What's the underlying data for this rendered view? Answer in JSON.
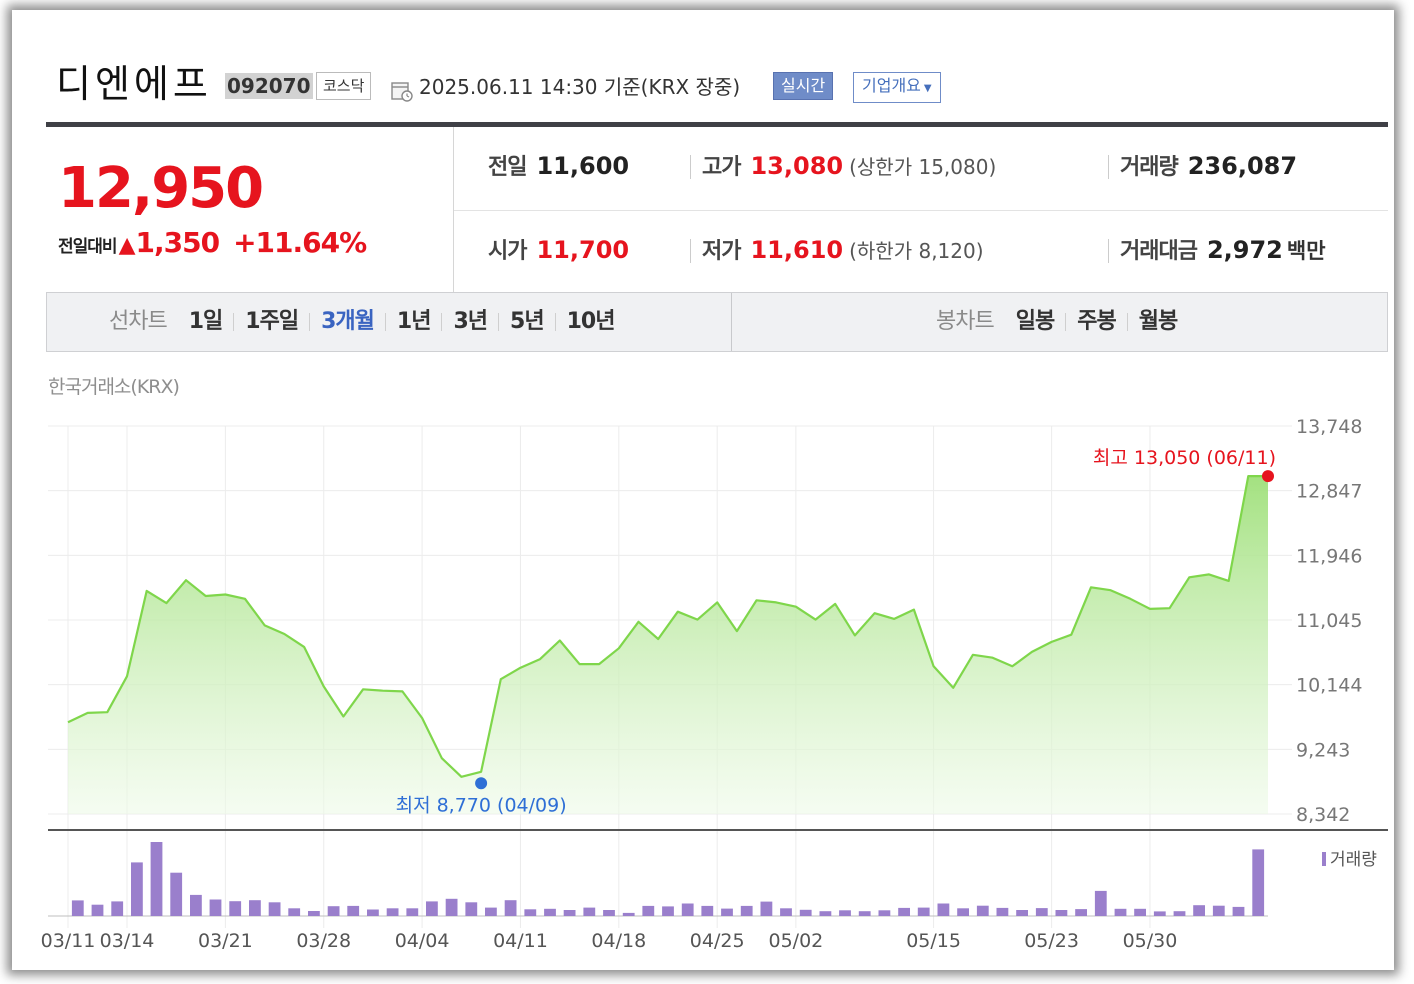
{
  "header": {
    "stock_name": "디엔에프",
    "stock_code": "092070",
    "market": "코스닥",
    "timestamp": "2025.06.11 14:30",
    "basis": "기준(KRX 장중)",
    "realtime_label": "실시간",
    "company_button_label": "기업개요"
  },
  "price": {
    "current": "12,950",
    "change_label": "전일대비",
    "change_amount": "1,350",
    "change_rate": "+11.64%"
  },
  "stats": {
    "prev_close_label": "전일",
    "prev_close": "11,600",
    "open_label": "시가",
    "open": "11,700",
    "high_label": "고가",
    "high": "13,080",
    "upper_limit_text": "(상한가 15,080)",
    "low_label": "저가",
    "low": "11,610",
    "lower_limit_text": "(하한가 8,120)",
    "volume_label": "거래량",
    "volume": "236,087",
    "trade_value_label": "거래대금",
    "trade_value": "2,972",
    "trade_value_unit": "백만"
  },
  "tabs": {
    "line_chart_label": "선차트",
    "periods": [
      "1일",
      "1주일",
      "3개월",
      "1년",
      "3년",
      "5년",
      "10년"
    ],
    "active_period": "3개월",
    "candle_label": "봉차트",
    "candles": [
      "일봉",
      "주봉",
      "월봉"
    ]
  },
  "exchange_label": "한국거래소(KRX)",
  "colors": {
    "accent_red": "#e6141e",
    "low_blue": "#2f6fd6",
    "line_green": "#7fd64b",
    "volume_purple": "#9a7fcc",
    "tab_active": "#3a64c1"
  },
  "chart_data": {
    "type": "area",
    "y_axis_ticks": [
      "13,748",
      "12,847",
      "11,946",
      "11,045",
      "10,144",
      "9,243",
      "8,342"
    ],
    "ylim": [
      8342,
      13748
    ],
    "x_tick_labels": [
      "03/11",
      "03/14",
      "03/21",
      "03/28",
      "04/04",
      "04/11",
      "04/18",
      "04/25",
      "05/02",
      "05/15",
      "05/23",
      "05/30"
    ],
    "dates": [
      "03/11",
      "03/12",
      "03/13",
      "03/14",
      "03/17",
      "03/18",
      "03/19",
      "03/20",
      "03/21",
      "03/24",
      "03/25",
      "03/26",
      "03/27",
      "03/28",
      "03/31",
      "04/01",
      "04/02",
      "04/03",
      "04/04",
      "04/07",
      "04/08",
      "04/09",
      "04/10",
      "04/11",
      "04/14",
      "04/15",
      "04/16",
      "04/17",
      "04/18",
      "04/21",
      "04/22",
      "04/23",
      "04/24",
      "04/25",
      "04/28",
      "04/29",
      "04/30",
      "05/02",
      "05/07",
      "05/08",
      "05/09",
      "05/12",
      "05/13",
      "05/14",
      "05/15",
      "05/16",
      "05/19",
      "05/20",
      "05/21",
      "05/22",
      "05/23",
      "05/26",
      "05/27",
      "05/28",
      "05/29",
      "05/30",
      "06/02",
      "06/04",
      "06/05",
      "06/09",
      "06/10",
      "06/11"
    ],
    "close": [
      9620,
      9750,
      9760,
      10260,
      11450,
      11280,
      11600,
      11380,
      11400,
      11340,
      10970,
      10850,
      10670,
      10120,
      9700,
      10080,
      10060,
      10050,
      9680,
      9120,
      8860,
      8930,
      10220,
      10380,
      10500,
      10760,
      10430,
      10430,
      10650,
      11020,
      10780,
      11160,
      11050,
      11290,
      10890,
      11320,
      11290,
      11230,
      11050,
      11270,
      10830,
      11140,
      11060,
      11190,
      10400,
      10100,
      10560,
      10520,
      10400,
      10600,
      10740,
      10840,
      11500,
      11460,
      11340,
      11200,
      11210,
      11640,
      11680,
      11590,
      13050,
      13050
    ],
    "volume_bars": [
      6.5,
      4.7,
      6.1,
      22.4,
      30.9,
      18.1,
      8.8,
      6.9,
      6.2,
      6.6,
      5.7,
      3.2,
      2.1,
      4.1,
      4.2,
      2.7,
      3.2,
      3.2,
      6.1,
      7.2,
      5.7,
      3.5,
      6.6,
      2.8,
      3.0,
      2.5,
      3.5,
      2.5,
      1.3,
      4.2,
      4.0,
      5.2,
      4.2,
      3.1,
      4.2,
      6.0,
      3.2,
      2.6,
      2.0,
      2.4,
      2.0,
      2.4,
      3.4,
      3.5,
      5.2,
      3.2,
      4.3,
      3.4,
      2.5,
      3.3,
      2.5,
      2.9,
      10.5,
      3.0,
      3.0,
      1.9,
      2.0,
      4.5,
      4.3,
      3.8,
      27.8
    ],
    "volume_legend": "거래량",
    "max_annotation": {
      "label": "최고",
      "value": "13,050",
      "date": "(06/11)"
    },
    "min_annotation": {
      "label": "최저",
      "value": "8,770",
      "date": "(04/09)"
    }
  }
}
